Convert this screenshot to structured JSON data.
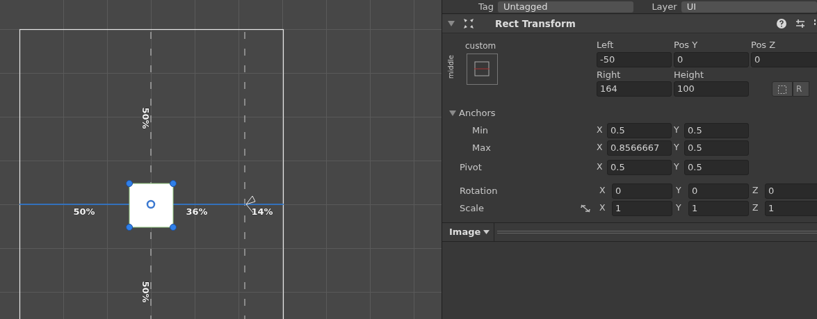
{
  "scene": {
    "labels": [
      {
        "text": "50%",
        "vertical": true
      },
      {
        "text": "50%",
        "vertical": false
      },
      {
        "text": "36%",
        "vertical": false
      },
      {
        "text": "14%",
        "vertical": false
      },
      {
        "text": "50%",
        "vertical": true
      }
    ]
  },
  "inspector": {
    "tag_label": "Tag",
    "tag_value": "Untagged",
    "layer_label": "Layer",
    "layer_value": "UI",
    "component": {
      "title": "Rect Transform",
      "expanded": true,
      "preset_label": "custom",
      "preset_side": "middle",
      "fields": [
        {
          "label": "Left",
          "value": "-50"
        },
        {
          "label": "Pos Y",
          "value": "0"
        },
        {
          "label": "Pos Z",
          "value": "0"
        },
        {
          "label": "Right",
          "value": "164"
        },
        {
          "label": "Height",
          "value": "100"
        }
      ],
      "edit_buttons": [
        "R"
      ],
      "anchors": {
        "label": "Anchors",
        "expanded": true,
        "rows": [
          {
            "label": "Min",
            "values": [
              {
                "axis": "X",
                "value": "0.5"
              },
              {
                "axis": "Y",
                "value": "0.5"
              }
            ]
          },
          {
            "label": "Max",
            "values": [
              {
                "axis": "X",
                "value": "0.8566667"
              },
              {
                "axis": "Y",
                "value": "0.5"
              }
            ]
          }
        ]
      },
      "transforms": [
        {
          "label": "Pivot",
          "linked": false,
          "values": [
            {
              "axis": "X",
              "value": "0.5"
            },
            {
              "axis": "Y",
              "value": "0.5"
            }
          ]
        },
        {
          "label": "Rotation",
          "linked": false,
          "values": [
            {
              "axis": "X",
              "value": "0"
            },
            {
              "axis": "Y",
              "value": "0"
            },
            {
              "axis": "Z",
              "value": "0"
            }
          ]
        },
        {
          "label": "Scale",
          "linked": true,
          "values": [
            {
              "axis": "X",
              "value": "1"
            },
            {
              "axis": "Y",
              "value": "1"
            },
            {
              "axis": "Z",
              "value": "1"
            }
          ]
        }
      ]
    },
    "next_component": {
      "title": "Image"
    }
  }
}
